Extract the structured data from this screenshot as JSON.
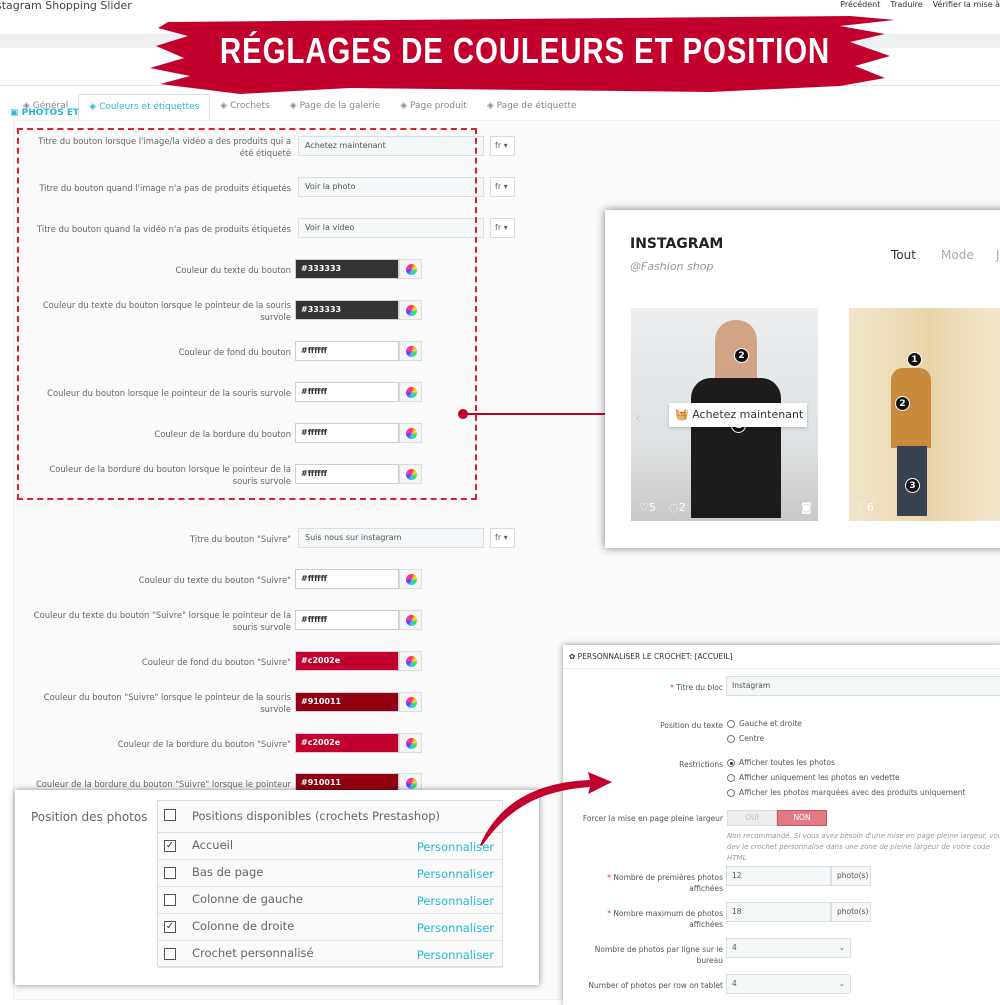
{
  "app": {
    "title": "stagram Shopping Slider",
    "links": [
      "Précédent",
      "Traduire",
      "Vérifier la mise à"
    ]
  },
  "section": "PHOTOS ET VIDÉOS",
  "banner": "RÉGLAGES DE COULEURS ET POSITION",
  "tabs": [
    {
      "label": "Général",
      "icon": "gears-icon"
    },
    {
      "label": "Couleurs et étiquettes",
      "icon": "contrast-icon",
      "active": true
    },
    {
      "label": "Crochets",
      "icon": "image-icon"
    },
    {
      "label": "Page de la galerie",
      "icon": "file-icon"
    },
    {
      "label": "Page produit",
      "icon": "window-icon"
    },
    {
      "label": "Page de étiquette",
      "icon": "tag-icon"
    }
  ],
  "form": [
    {
      "label": "Titre du bouton lorsque l'image/la vidéo a des produits qui a été étiqueté",
      "type": "text",
      "value": "Achetez maintenant",
      "lang": "fr"
    },
    {
      "label": "Titre du bouton quand l'image n'a pas de produits étiquetés",
      "type": "text",
      "value": "Voir la photo",
      "lang": "fr"
    },
    {
      "label": "Titre du bouton quand la vidéo n'a pas de produits étiquetés",
      "type": "text",
      "value": "Voir la video",
      "lang": "fr"
    },
    {
      "label": "Couleur du texte du bouton",
      "type": "color",
      "value": "#333333"
    },
    {
      "label": "Couleur du texte du bouton lorsque le pointeur de la souris survole",
      "type": "color",
      "value": "#333333"
    },
    {
      "label": "Couleur de fond du bouton",
      "type": "color",
      "value": "#ffffff"
    },
    {
      "label": "Couleur du bouton lorsque le pointeur de la souris survole",
      "type": "color",
      "value": "#ffffff"
    },
    {
      "label": "Couleur de la bordure du bouton",
      "type": "color",
      "value": "#ffffff"
    },
    {
      "label": "Couleur de la bordure du bouton lorsque le pointeur de la souris survole",
      "type": "color",
      "value": "#ffffff"
    },
    {
      "label": "Titre du bouton \"Suivre\"",
      "type": "text",
      "value": "Suis nous sur instagram",
      "lang": "fr"
    },
    {
      "label": "Couleur du texte du bouton \"Suivre\"",
      "type": "color",
      "value": "#ffffff"
    },
    {
      "label": "Couleur du texte du bouton \"Suivre\" lorsque le pointeur de la souris survole",
      "type": "color",
      "value": "#ffffff"
    },
    {
      "label": "Couleur de fond du bouton \"Suivre\"",
      "type": "color",
      "value": "#c2002e"
    },
    {
      "label": "Couleur du bouton \"Suivre\" lorsque le pointeur de la souris survole",
      "type": "color",
      "value": "#910011"
    },
    {
      "label": "Couleur de la bordure du bouton \"Suivre\"",
      "type": "color",
      "value": "#c2002e"
    },
    {
      "label": "Couleur de la bordure du bouton \"Suivre\" lorsque le pointeur",
      "type": "color",
      "value": "#910011"
    }
  ],
  "preview": {
    "title": "INSTAGRAM",
    "subtitle": "@Fashion shop",
    "filters": [
      "Tout",
      "Mode",
      "J"
    ],
    "button": "Achetez maintenant",
    "photo1": {
      "likes": "5",
      "comments": "2",
      "tags": [
        "2",
        "1"
      ]
    },
    "photo2": {
      "likes": "6",
      "tags": [
        "1",
        "2",
        "3"
      ]
    }
  },
  "hook": {
    "header": "PERSONNALISER LE CROCHET: [ACCUEIL]",
    "block_title_label": "Titre du bloc",
    "block_title": "Instagram",
    "text_position_label": "Position du texte",
    "text_position": [
      "Gauche et droite",
      "Centre"
    ],
    "restrictions_label": "Restrictions",
    "restrictions": [
      "Afficher toutes les photos",
      "Afficher uniquement les photos en vedette",
      "Afficher les photos marquées avec des produits uniquement"
    ],
    "fullwidth_label": "Forcer la mise en page pleine largeur",
    "yes": "OUI",
    "no": "NON",
    "fullwidth_help": "Non recommandé. Si vous avez besoin d'une mise en page pleine largeur, vous dev le crochet personnalisé dans une zone de pleine largeur de votre code HTML",
    "first_label": "Nombre de premières photos affichées",
    "first": "12",
    "max_label": "Nombre maximum de photos affichées",
    "max": "18",
    "unit": "photo(s)",
    "desktop_label": "Nombre de photos par ligne sur le bureau",
    "desktop": "4",
    "tablet_label": "Number of photos per row on tablet",
    "tablet": "4"
  },
  "positions": {
    "label": "Position des photos",
    "header": "Positions disponibles (crochets Prestashop)",
    "link": "Personnaliser",
    "items": [
      {
        "name": "Accueil",
        "checked": true
      },
      {
        "name": "Bas de page",
        "checked": false
      },
      {
        "name": "Colonne de gauche",
        "checked": false
      },
      {
        "name": "Colonne de droite",
        "checked": true
      },
      {
        "name": "Crochet personnalisé",
        "checked": false
      }
    ]
  },
  "colors": {
    "accent": "#25b9d7",
    "brand_red": "#c2002e"
  }
}
